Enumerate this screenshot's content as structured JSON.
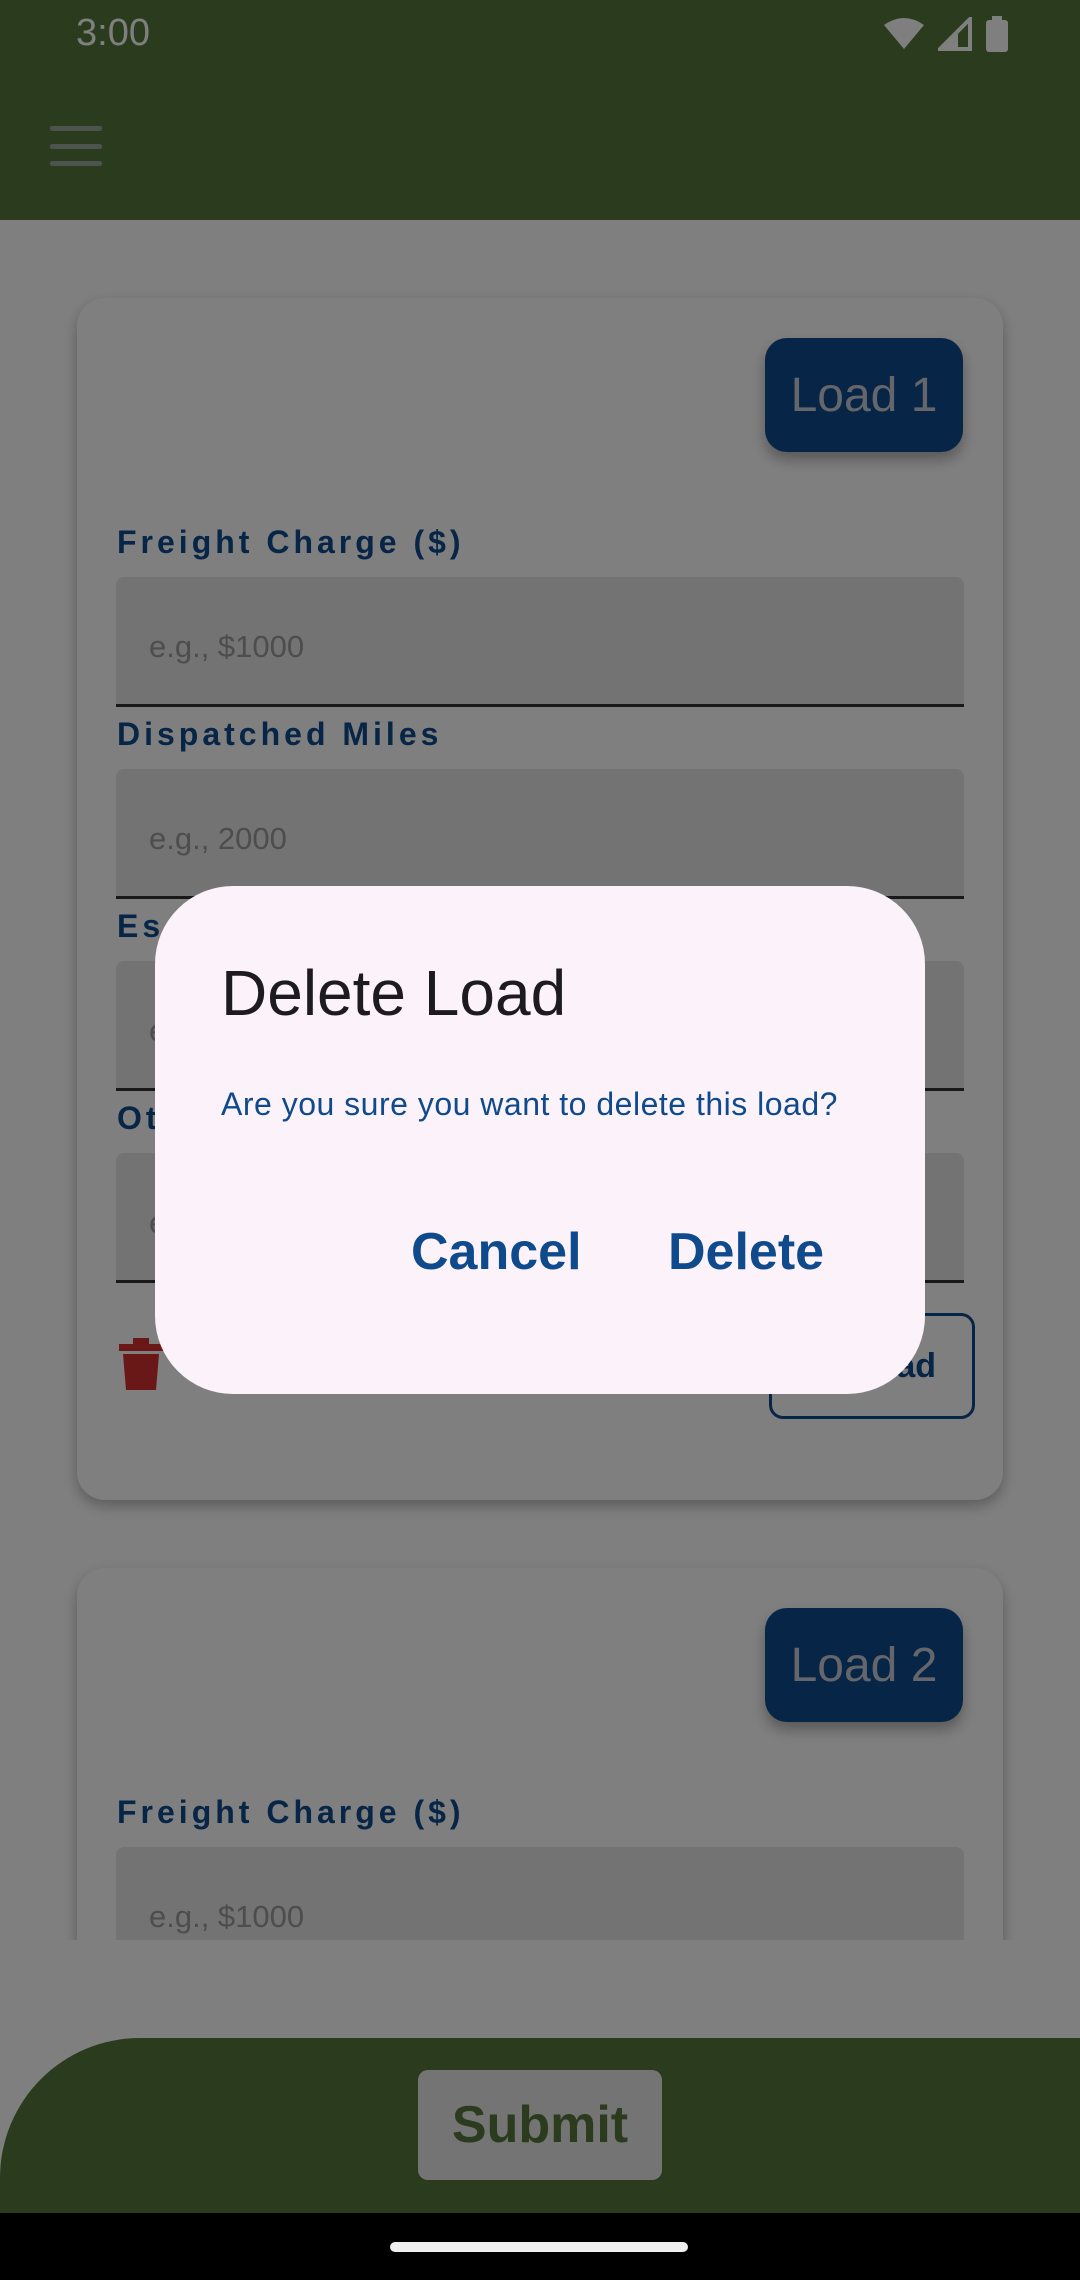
{
  "status": {
    "time": "3:00",
    "wifi_icon": "wifi-icon",
    "signal_icon": "signal-icon",
    "battery_icon": "battery-icon"
  },
  "app_bar": {
    "menu_icon": "menu-icon"
  },
  "cards": [
    {
      "badge": "Load 1",
      "fields": [
        {
          "label": "Freight Charge ($)",
          "placeholder": "e.g., $1000"
        },
        {
          "label": "Dispatched Miles",
          "placeholder": "e.g., 2000"
        },
        {
          "label": "Es",
          "placeholder": "e"
        },
        {
          "label": "Ot",
          "placeholder": "e"
        }
      ],
      "add_button": "ad"
    },
    {
      "badge": "Load 2",
      "fields": [
        {
          "label": "Freight Charge ($)",
          "placeholder": "e.g., $1000"
        }
      ]
    }
  ],
  "submit": {
    "label": "Submit"
  },
  "dialog": {
    "title": "Delete Load",
    "message": "Are you sure you want to delete this load?",
    "cancel": "Cancel",
    "delete": "Delete"
  },
  "colors": {
    "primary_green": "#55783a",
    "primary_blue": "#0f4a8c",
    "danger_red": "#d32f2f",
    "dialog_bg": "#fcf2fa"
  }
}
